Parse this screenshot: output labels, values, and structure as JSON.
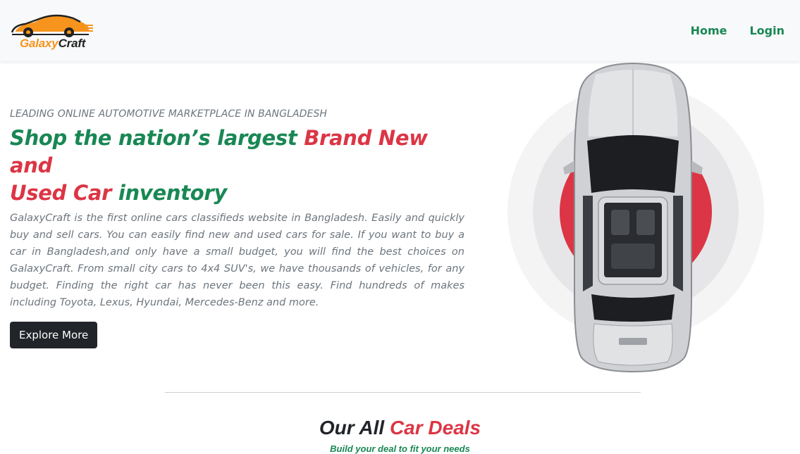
{
  "brand": {
    "name_part1": "Galaxy",
    "name_part2": "Craft",
    "color_orange": "#f7941d",
    "color_dark": "#222222"
  },
  "nav": {
    "items": [
      {
        "label": "Home"
      },
      {
        "label": "Login"
      }
    ],
    "color": "#198754"
  },
  "hero": {
    "kicker": "LEADING ONLINE AUTOMOTIVE MARKETPLACE IN BANGLADESH",
    "headline": {
      "part1": "Shop the nation’s largest ",
      "part2": "Brand New and",
      "part3": "Used Car",
      "part4": " inventory"
    },
    "description": "GalaxyCraft is the first online cars classifieds website in Bangladesh. Easily and quickly buy and sell cars. You can easily find new and used cars for sale. If you want to buy a car in Bangladesh,and only have a small budget, you will find the best choices on GalaxyCraft. From small city cars to 4x4 SUV's, we have thousands of vehicles, for any budget. Finding the right car has never been this easy. Find hundreds of makes including Toyota, Lexus, Hyundai, Mercedes-Benz and more.",
    "button_label": "Explore More",
    "image_icon": "silver-car-top-view",
    "accent_red": "#dc3545"
  },
  "deals": {
    "title_part1": "Our All ",
    "title_part2": "Car Deals",
    "subtitle": "Build your deal to fit your needs"
  }
}
